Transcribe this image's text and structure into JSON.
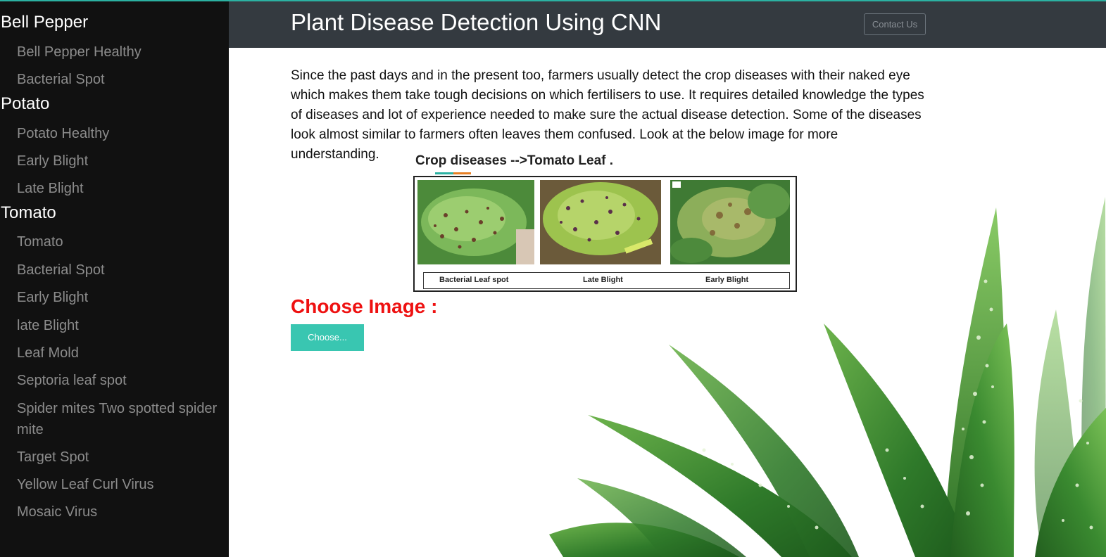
{
  "sidebar": {
    "categories": [
      {
        "label": "Bell Pepper",
        "items": [
          "Bell Pepper Healthy",
          "Bacterial Spot"
        ]
      },
      {
        "label": "Potato",
        "items": [
          "Potato Healthy",
          "Early Blight",
          "Late Blight"
        ]
      },
      {
        "label": "Tomato",
        "items": [
          "Tomato",
          "Bacterial Spot",
          "Early Blight",
          "late Blight",
          "Leaf Mold",
          "Septoria leaf spot",
          "Spider mites Two spotted spider mite",
          "Target Spot",
          "Yellow Leaf Curl Virus",
          "Mosaic Virus"
        ]
      }
    ]
  },
  "header": {
    "title": "Plant Disease Detection Using CNN",
    "contact_label": "Contact Us"
  },
  "main": {
    "intro": "Since the past days and in the present too, farmers usually detect the crop diseases with their naked eye which makes them take tough decisions on which fertilisers to use. It requires detailed knowledge the types of diseases and lot of experience needed to make sure the actual disease detection. Some of the diseases look almost similar to farmers often leaves them confused. Look at the below image for more understanding.",
    "figure": {
      "title": "Crop diseases -->Tomato Leaf .",
      "captions": [
        "Bacterial Leaf spot",
        "Late Blight",
        "Early Blight"
      ]
    },
    "choose_label": "Choose Image :",
    "choose_button": "Choose..."
  },
  "colors": {
    "accent": "#39c6b1",
    "header_bg": "#343a40",
    "sidebar_bg": "#111111",
    "choose_label": "#ee1111"
  }
}
